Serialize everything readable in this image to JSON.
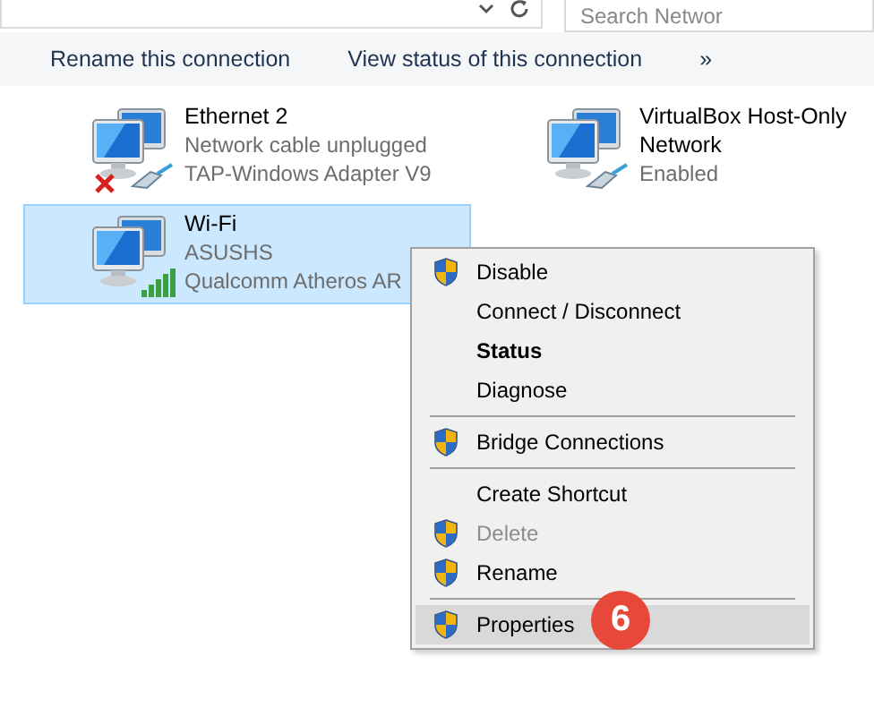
{
  "search": {
    "placeholder": "Search Networ"
  },
  "toolbar": {
    "items": [
      {
        "label": "Rename this connection"
      },
      {
        "label": "View status of this connection"
      },
      {
        "label": "»"
      }
    ]
  },
  "connections": [
    {
      "name": "Ethernet 2",
      "lines": [
        "Network cable unplugged",
        "TAP-Windows Adapter V9"
      ],
      "kind": "unplugged",
      "selected": false
    },
    {
      "name": "VirtualBox Host-Only Network",
      "lines": [
        "Enabled"
      ],
      "kind": "cable",
      "selected": false
    },
    {
      "name": "Wi-Fi",
      "lines": [
        "ASUSHS",
        "Qualcomm Atheros AR"
      ],
      "kind": "wireless",
      "selected": true
    }
  ],
  "context_menu": {
    "items": [
      {
        "kind": "item",
        "label": "Disable",
        "shield": true,
        "bold": false,
        "disabled": false,
        "selected": false
      },
      {
        "kind": "item",
        "label": "Connect / Disconnect",
        "shield": false,
        "bold": false,
        "disabled": false,
        "selected": false
      },
      {
        "kind": "item",
        "label": "Status",
        "shield": false,
        "bold": true,
        "disabled": false,
        "selected": false
      },
      {
        "kind": "item",
        "label": "Diagnose",
        "shield": false,
        "bold": false,
        "disabled": false,
        "selected": false
      },
      {
        "kind": "separator"
      },
      {
        "kind": "item",
        "label": "Bridge Connections",
        "shield": true,
        "bold": false,
        "disabled": false,
        "selected": false
      },
      {
        "kind": "separator"
      },
      {
        "kind": "item",
        "label": "Create Shortcut",
        "shield": false,
        "bold": false,
        "disabled": false,
        "selected": false
      },
      {
        "kind": "item",
        "label": "Delete",
        "shield": true,
        "bold": false,
        "disabled": true,
        "selected": false
      },
      {
        "kind": "item",
        "label": "Rename",
        "shield": true,
        "bold": false,
        "disabled": false,
        "selected": false
      },
      {
        "kind": "separator"
      },
      {
        "kind": "item",
        "label": "Properties",
        "shield": true,
        "bold": false,
        "disabled": false,
        "selected": true
      }
    ]
  },
  "step_badge": {
    "label": "6"
  }
}
